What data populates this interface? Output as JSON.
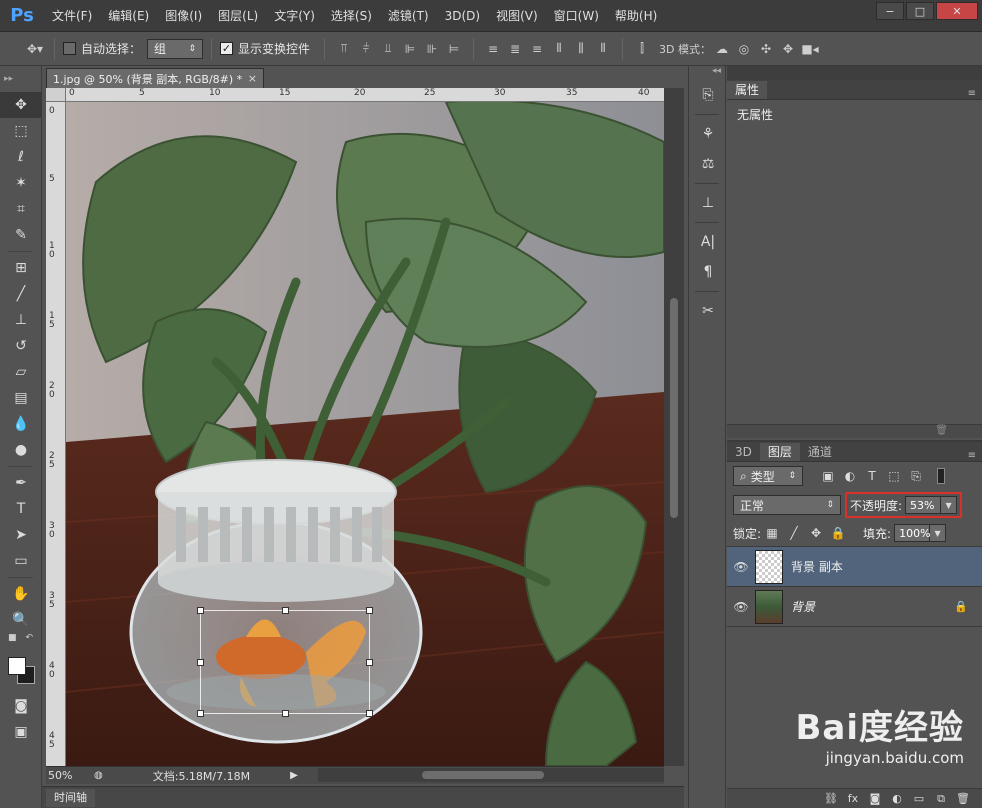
{
  "app": {
    "logo": "Ps"
  },
  "menu": [
    "文件(F)",
    "编辑(E)",
    "图像(I)",
    "图层(L)",
    "文字(Y)",
    "选择(S)",
    "滤镜(T)",
    "3D(D)",
    "视图(V)",
    "窗口(W)",
    "帮助(H)"
  ],
  "window_controls": {
    "minimize": "−",
    "maximize": "□",
    "close": "✕"
  },
  "options": {
    "auto_select_label": "自动选择：",
    "auto_select_checked": false,
    "auto_select_target": "组",
    "show_transform_label": "显示变换控件",
    "show_transform_checked": true,
    "mode_3d_label": "3D 模式："
  },
  "document": {
    "tab_title": "1.jpg @ 50% (背景 副本, RGB/8#) *",
    "close": "×",
    "ruler_h_ticks": [
      "0",
      "5",
      "10",
      "15",
      "20",
      "25",
      "30",
      "35",
      "40"
    ],
    "ruler_v_ticks": [
      "0",
      "5",
      "1\n0",
      "1\n5",
      "2\n0",
      "2\n5",
      "3\n0",
      "3\n5",
      "4\n0",
      "4\n5"
    ],
    "zoom": "50%",
    "doc_info": "文档:5.18M/7.18M"
  },
  "timeline_tab": "时间轴",
  "properties": {
    "tab": "属性",
    "content": "无属性"
  },
  "layers": {
    "tabs": [
      "3D",
      "图层",
      "通道"
    ],
    "active_tab": "图层",
    "filter_kind": "类型",
    "blend_mode": "正常",
    "opacity_label": "不透明度:",
    "opacity": "53%",
    "lock_label": "锁定:",
    "fill_label": "填充:",
    "fill": "100%",
    "items": [
      {
        "name": "背景 副本",
        "selected": true,
        "locked": false
      },
      {
        "name": "背景",
        "selected": false,
        "locked": true
      }
    ]
  },
  "watermark": {
    "logo": "Bai度经验",
    "url": "jingyan.baidu.com"
  },
  "colors": {
    "accent_highlight": "#d9302c",
    "selected_layer": "#51647c",
    "ps_blue": "#4fa3ff"
  }
}
